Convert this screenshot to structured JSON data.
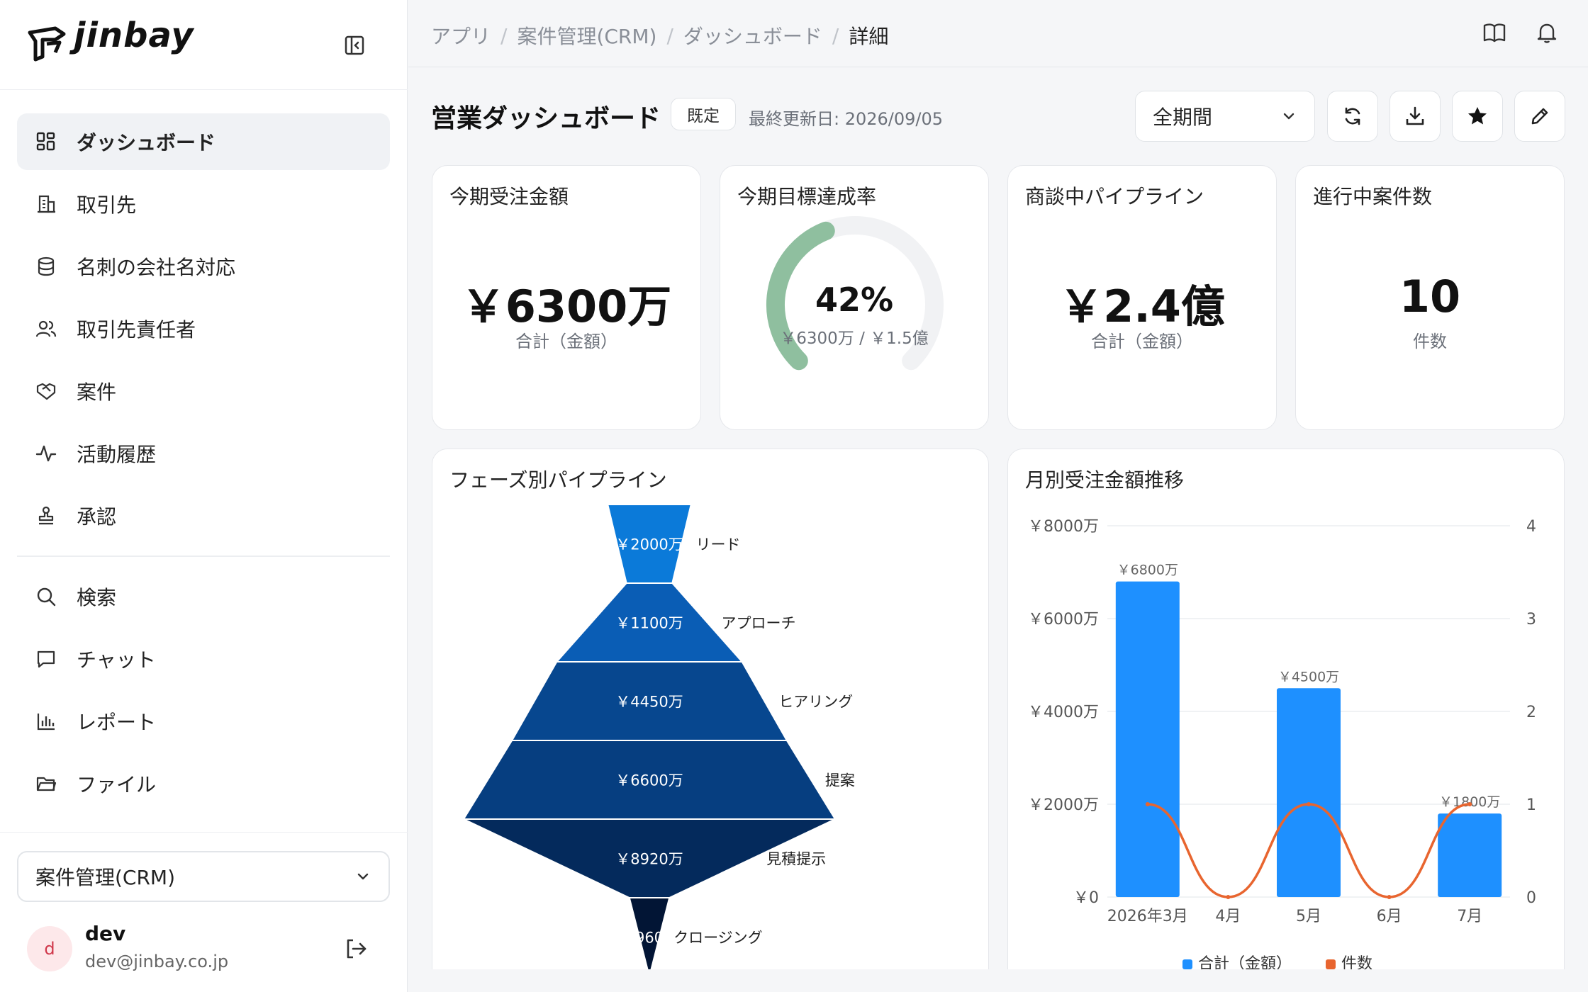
{
  "app": {
    "logo_text": "jinbay"
  },
  "sidebar": {
    "items": [
      {
        "label": "ダッシュボード",
        "icon": "dashboard-icon",
        "active": true
      },
      {
        "label": "取引先",
        "icon": "building-icon"
      },
      {
        "label": "名刺の会社名対応",
        "icon": "database-icon"
      },
      {
        "label": "取引先責任者",
        "icon": "users-icon"
      },
      {
        "label": "案件",
        "icon": "handshake-icon"
      },
      {
        "label": "活動履歴",
        "icon": "activity-icon"
      },
      {
        "label": "承認",
        "icon": "stamp-icon"
      },
      {
        "label": "検索",
        "icon": "search-icon"
      },
      {
        "label": "チャット",
        "icon": "chat-icon"
      },
      {
        "label": "レポート",
        "icon": "bar-chart-icon"
      },
      {
        "label": "ファイル",
        "icon": "folder-icon"
      }
    ],
    "app_select": "案件管理(CRM)",
    "user": {
      "initial": "d",
      "name": "dev",
      "email": "dev@jinbay.co.jp"
    }
  },
  "breadcrumb": [
    "アプリ",
    "案件管理(CRM)",
    "ダッシュボード",
    "詳細"
  ],
  "page": {
    "title": "営業ダッシュボード",
    "badge": "既定",
    "updated": "最終更新日: 2026/09/05",
    "period": "全期間"
  },
  "kpis": {
    "orders": {
      "title": "今期受注金額",
      "value": "￥6300万",
      "sub": "合計（金額）"
    },
    "achievement": {
      "title": "今期目標達成率",
      "value": "42%",
      "sub": "￥6300万 / ￥1.5億",
      "ratio": 0.42
    },
    "pipeline": {
      "title": "商談中パイプライン",
      "value": "￥2.4億",
      "sub": "合計（金額）"
    },
    "deals": {
      "title": "進行中案件数",
      "value": "10",
      "sub": "件数"
    }
  },
  "colors": {
    "accent_green": "#8fbf9f",
    "bar_blue": "#1e90ff",
    "line_orange": "#e8652f"
  },
  "chart_data": [
    {
      "type": "funnel",
      "title": "フェーズ別パイプライン",
      "categories": [
        "リード",
        "アプローチ",
        "ヒアリング",
        "提案",
        "見積提示",
        "クロージング"
      ],
      "values": [
        2000,
        1100,
        4450,
        6600,
        8920,
        960
      ],
      "value_labels": [
        "￥2000万",
        "￥1100万",
        "￥4450万",
        "￥6600万",
        "￥8920万",
        "￥960万"
      ],
      "colors": [
        "#0b7ad9",
        "#0a5db5",
        "#07478f",
        "#063e80",
        "#042a5c",
        "#021535"
      ]
    },
    {
      "type": "bar",
      "title": "月別受注金額推移",
      "categories": [
        "2026年3月",
        "4月",
        "5月",
        "6月",
        "7月"
      ],
      "series": [
        {
          "name": "合計（金額）",
          "type": "bar",
          "axis": "left",
          "values": [
            6800,
            0,
            4500,
            0,
            1800
          ],
          "labels": [
            "￥6800万",
            "",
            "￥4500万",
            "",
            "￥1800万"
          ]
        },
        {
          "name": "件数",
          "type": "line",
          "axis": "right",
          "values": [
            1,
            0,
            1,
            0,
            1
          ]
        }
      ],
      "y_left_ticks": [
        "￥0",
        "￥2000万",
        "￥4000万",
        "￥6000万",
        "￥8000万"
      ],
      "y_left_max": 8000,
      "y_right_ticks": [
        "0",
        "1",
        "2",
        "3",
        "4"
      ],
      "y_right_max": 4,
      "legend": "bottom"
    }
  ]
}
